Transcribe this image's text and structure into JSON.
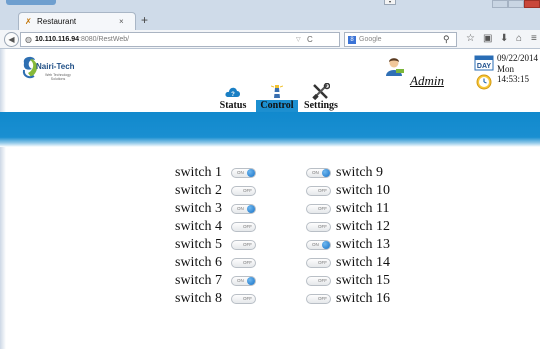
{
  "browser": {
    "tab_title": "Restaurant",
    "tab_close": "×",
    "new_tab": "+",
    "url_host": "10.110.116.94",
    "url_rest": ":8080/RestWeb/",
    "search_placeholder": "Google",
    "search_engine_letter": "8"
  },
  "header": {
    "brand_name": "Nairi-Tech",
    "brand_tagline": "Web Technology Solutions",
    "user_name": "Admin",
    "date": "09/22/2014",
    "calendar_badge": "DAY",
    "day": "Mon",
    "time": "14:53:15"
  },
  "nav": {
    "items": [
      {
        "label": "Status",
        "icon": "status-icon"
      },
      {
        "label": "Control",
        "icon": "lighthouse-icon",
        "active": true
      },
      {
        "label": "Settings",
        "icon": "tools-icon"
      }
    ]
  },
  "switches": {
    "on_text": "ON",
    "off_text": "OFF",
    "items": [
      {
        "label": "switch 1",
        "state": "on"
      },
      {
        "label": "switch 2",
        "state": "off"
      },
      {
        "label": "switch 3",
        "state": "on"
      },
      {
        "label": "switch 4",
        "state": "off"
      },
      {
        "label": "switch 5",
        "state": "off"
      },
      {
        "label": "switch 6",
        "state": "off"
      },
      {
        "label": "switch 7",
        "state": "on"
      },
      {
        "label": "switch 8",
        "state": "off"
      },
      {
        "label": "switch 9",
        "state": "on"
      },
      {
        "label": "switch 10",
        "state": "off"
      },
      {
        "label": "switch 11",
        "state": "off"
      },
      {
        "label": "switch 12",
        "state": "off"
      },
      {
        "label": "switch 13",
        "state": "on"
      },
      {
        "label": "switch 14",
        "state": "off"
      },
      {
        "label": "switch 15",
        "state": "off"
      },
      {
        "label": "switch 16",
        "state": "off"
      }
    ]
  },
  "colors": {
    "band_blue": "#1a8fd1",
    "active_tab": "#1c8fd0",
    "knob_blue": "#1670c6"
  }
}
